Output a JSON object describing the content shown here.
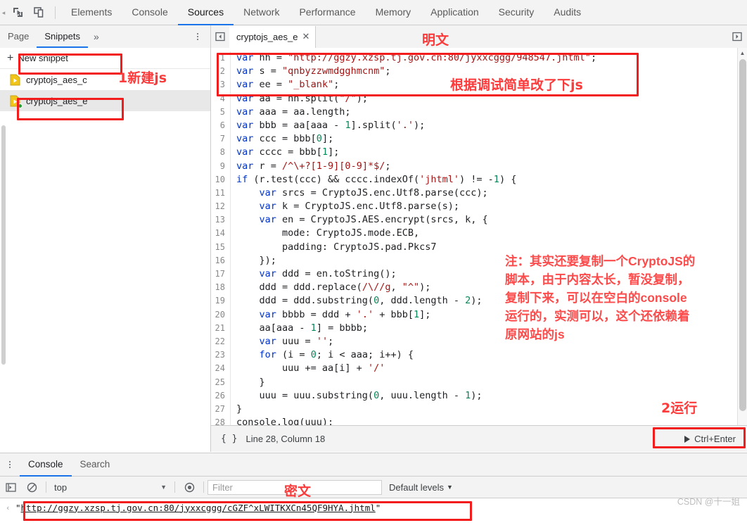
{
  "devtools": {
    "toolbar_icons": [
      "inspect-element-icon",
      "device-toolbar-icon"
    ],
    "panels": [
      {
        "label": "Elements",
        "active": false
      },
      {
        "label": "Console",
        "active": false
      },
      {
        "label": "Sources",
        "active": true
      },
      {
        "label": "Network",
        "active": false
      },
      {
        "label": "Performance",
        "active": false
      },
      {
        "label": "Memory",
        "active": false
      },
      {
        "label": "Application",
        "active": false
      },
      {
        "label": "Security",
        "active": false
      },
      {
        "label": "Audits",
        "active": false
      }
    ]
  },
  "navigator": {
    "tabs": [
      {
        "label": "Page",
        "active": false
      },
      {
        "label": "Snippets",
        "active": true
      }
    ],
    "more_label": "»",
    "new_snippet_label": "New snippet",
    "new_snippet_plus": "+",
    "snippets": [
      {
        "name": "cryptojs_aes_c",
        "selected": false,
        "has_dot": false
      },
      {
        "name": "cryptojs_aes_e",
        "selected": true,
        "has_dot": true
      }
    ]
  },
  "editor": {
    "tab_name": "cryptojs_aes_e",
    "tab_close": "✕",
    "lines": [
      {
        "n": "1",
        "code": "var hh = \"http://ggzy.xzsp.tj.gov.cn:80/jyxxcggg/948547.jhtml\";"
      },
      {
        "n": "2",
        "code": "var s = \"qnbyzzwmdgghmcnm\";"
      },
      {
        "n": "3",
        "code": "var ee = \"_blank\";"
      },
      {
        "n": "4",
        "code": "var aa = hh.split(\"/\");"
      },
      {
        "n": "5",
        "code": "var aaa = aa.length;"
      },
      {
        "n": "6",
        "code": "var bbb = aa[aaa - 1].split('.');"
      },
      {
        "n": "7",
        "code": "var ccc = bbb[0];"
      },
      {
        "n": "8",
        "code": "var cccc = bbb[1];"
      },
      {
        "n": "9",
        "code": "var r = /^\\+?[1-9][0-9]*$/;"
      },
      {
        "n": "10",
        "code": "if (r.test(ccc) && cccc.indexOf('jhtml') != -1) {"
      },
      {
        "n": "11",
        "code": "    var srcs = CryptoJS.enc.Utf8.parse(ccc);"
      },
      {
        "n": "12",
        "code": "    var k = CryptoJS.enc.Utf8.parse(s);"
      },
      {
        "n": "13",
        "code": "    var en = CryptoJS.AES.encrypt(srcs, k, {"
      },
      {
        "n": "14",
        "code": "        mode: CryptoJS.mode.ECB,"
      },
      {
        "n": "15",
        "code": "        padding: CryptoJS.pad.Pkcs7"
      },
      {
        "n": "16",
        "code": "    });"
      },
      {
        "n": "17",
        "code": "    var ddd = en.toString();"
      },
      {
        "n": "18",
        "code": "    ddd = ddd.replace(/\\//g, \"^\");"
      },
      {
        "n": "19",
        "code": "    ddd = ddd.substring(0, ddd.length - 2);"
      },
      {
        "n": "20",
        "code": "    var bbbb = ddd + '.' + bbb[1];"
      },
      {
        "n": "21",
        "code": "    aa[aaa - 1] = bbbb;"
      },
      {
        "n": "22",
        "code": "    var uuu = '';"
      },
      {
        "n": "23",
        "code": "    for (i = 0; i < aaa; i++) {"
      },
      {
        "n": "24",
        "code": "        uuu += aa[i] + '/'"
      },
      {
        "n": "25",
        "code": "    }"
      },
      {
        "n": "26",
        "code": "    uuu = uuu.substring(0, uuu.length - 1);"
      },
      {
        "n": "27",
        "code": "}"
      },
      {
        "n": "28",
        "code": "console.log(uuu);"
      }
    ]
  },
  "status_bar": {
    "format_icon": "{ }",
    "position": "Line 28, Column 18",
    "run_shortcut": "Ctrl+Enter"
  },
  "drawer": {
    "tabs": [
      {
        "label": "Console",
        "active": true
      },
      {
        "label": "Search",
        "active": false
      }
    ]
  },
  "console_toolbar": {
    "icons": [
      "clear-console-icon",
      "no-entry-icon",
      "eye-icon"
    ],
    "context": "top",
    "filter_placeholder": "Filter",
    "levels": "Default levels"
  },
  "console_output": {
    "arrow": "‹",
    "quote_open": "\"",
    "url": "http://ggzy.xzsp.tj.gov.cn:80/jyxxcggg/cGZF^xLWITKXCn45QF9HYA.jhtml",
    "quote_close": "\""
  },
  "annotations": {
    "plaintext_label": "明文",
    "edited_js_label": "根据调试简单改了下js",
    "new_js_label": "1新建js",
    "run_label": "2运行",
    "ciphertext_label": "密文",
    "note": "注：其实还要复制一个CryptoJS的\n脚本，由于内容太长，暂没复制，\n复制下来，可以在空白的console\n运行的，实测可以，这个还依赖着\n原网站的js"
  },
  "watermark": "CSDN @十一姐",
  "colors": {
    "accent": "#1a73e8",
    "annotation_red": "#f21c1c",
    "annotation_text": "#fb4b4b",
    "chrome_bg": "#f3f3f3",
    "selected_row": "#e8e8e8",
    "snippet_dot": "#1e9e2e"
  }
}
